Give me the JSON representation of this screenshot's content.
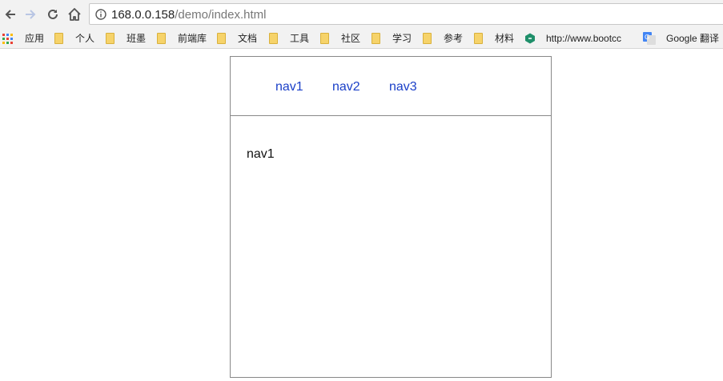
{
  "browser": {
    "url_host": "168.0.0.158",
    "url_path": "/demo/index.html",
    "icons": [
      "back-icon",
      "forward-icon",
      "reload-icon",
      "home-icon",
      "info-icon"
    ]
  },
  "bookmarks": {
    "apps_label": "应用",
    "items": [
      {
        "label": "个人"
      },
      {
        "label": "班墨"
      },
      {
        "label": "前端库"
      },
      {
        "label": "文档"
      },
      {
        "label": "工具"
      },
      {
        "label": "社区"
      },
      {
        "label": "学习"
      },
      {
        "label": "参考"
      },
      {
        "label": "材料"
      }
    ],
    "bootcdn_label": "http://www.bootcc",
    "translate_label": "Google 翻译"
  },
  "page": {
    "nav": [
      "nav1",
      "nav2",
      "nav3"
    ],
    "content": "nav1"
  },
  "colors": {
    "link": "#1a3fc8",
    "border": "#888888",
    "folder": "#f6d36a"
  }
}
